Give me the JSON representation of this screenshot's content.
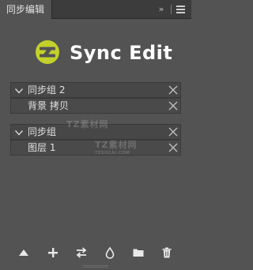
{
  "tab": {
    "title": "同步编辑"
  },
  "header": {
    "collapse_glyph": "»",
    "menu_icon": "hamburger-icon"
  },
  "logo": {
    "icon": "sync-edit-logo-icon",
    "brand_color": "#c3d12a",
    "text": "Sync Edit"
  },
  "groups": [
    {
      "name": "同步组 2",
      "items": [
        "背景 拷贝"
      ]
    },
    {
      "name": "同步组",
      "items": [
        "图层 1"
      ]
    }
  ],
  "watermark": [
    {
      "title": "TZ素材网",
      "url": "TZSUCAI.COM"
    },
    {
      "title": "TZ素材网",
      "url": "TZSUCAI.COM"
    }
  ],
  "toolbar": {
    "icons": [
      "move-up-icon",
      "add-icon",
      "swap-icon",
      "drop-icon",
      "folder-icon",
      "trash-icon"
    ]
  }
}
